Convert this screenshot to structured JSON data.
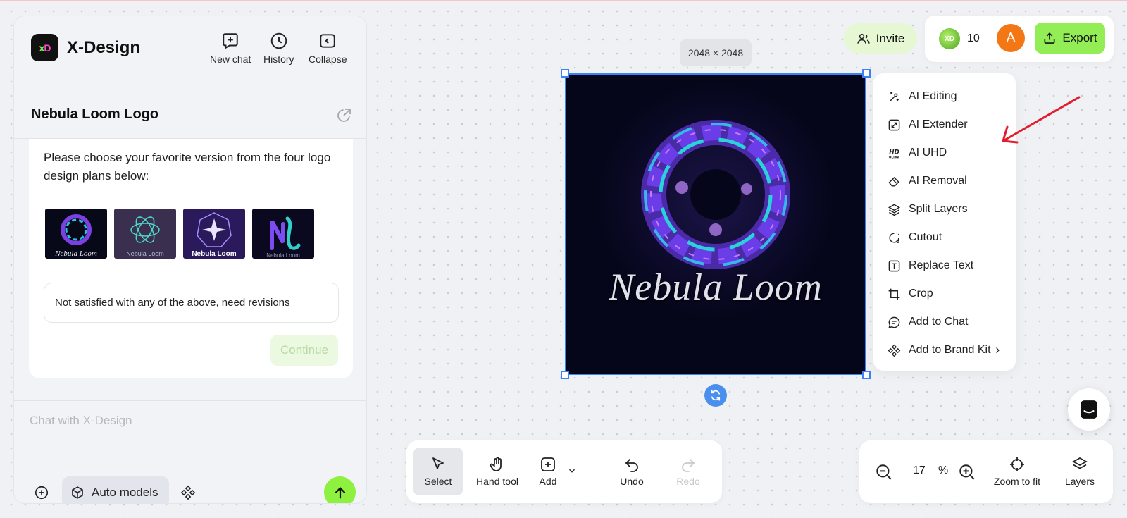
{
  "app": {
    "name": "X-Design",
    "logo_text_x": "x",
    "logo_text_d": "D"
  },
  "header": {
    "new_chat": "New chat",
    "history": "History",
    "collapse": "Collapse"
  },
  "conversation": {
    "title": "Nebula Loom Logo",
    "prompt": "Please choose your favorite version from the four logo design plans below:",
    "options": [
      {
        "label": "Nebula Loom"
      },
      {
        "label": "Nebula Loom"
      },
      {
        "label": "Nebula Loom"
      },
      {
        "label": "Nebula Loom"
      }
    ],
    "revise_option": "Not satisfied with any of the above, need revisions",
    "continue_label": "Continue"
  },
  "composer": {
    "placeholder": "Chat with X-Design",
    "model_label": "Auto models"
  },
  "canvas": {
    "size_badge": "2048 × 2048",
    "artwork_text": "Nebula Loom"
  },
  "context_menu": {
    "items": [
      {
        "label": "AI Editing",
        "icon": "magic-wand-icon"
      },
      {
        "label": "AI Extender",
        "icon": "expand-icon"
      },
      {
        "label": "AI UHD",
        "icon": "hd-ultra-icon"
      },
      {
        "label": "AI Removal",
        "icon": "eraser-icon"
      },
      {
        "label": "Split Layers",
        "icon": "layers-icon"
      },
      {
        "label": "Cutout",
        "icon": "cutout-icon"
      },
      {
        "label": "Replace Text",
        "icon": "text-replace-icon"
      },
      {
        "label": "Crop",
        "icon": "crop-icon"
      },
      {
        "label": "Add to Chat",
        "icon": "chat-icon"
      },
      {
        "label": "Add to Brand Kit",
        "icon": "brand-kit-icon"
      }
    ]
  },
  "topbar": {
    "invite": "Invite",
    "credits": "10",
    "avatar_initial": "A",
    "export": "Export"
  },
  "toolbar": {
    "select": "Select",
    "hand_tool": "Hand tool",
    "add": "Add",
    "undo": "Undo",
    "redo": "Redo"
  },
  "zoom": {
    "value": "17",
    "unit": "%",
    "zoom_to_fit": "Zoom to fit",
    "layers": "Layers"
  },
  "colors": {
    "accent_green": "#93ee56",
    "selection_blue": "#3b82f6",
    "annotation_red": "#e11d2e"
  }
}
